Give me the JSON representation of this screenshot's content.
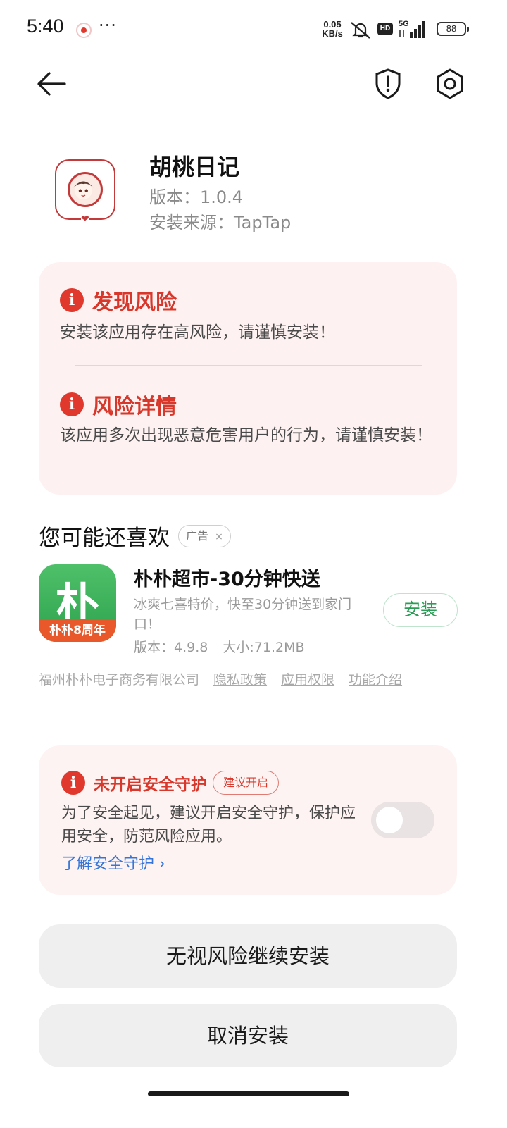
{
  "status_bar": {
    "time": "5:40",
    "dots": "···",
    "net_speed_value": "0.05",
    "net_speed_unit": "KB/s",
    "hd": "HD",
    "network": "5G",
    "battery": "88"
  },
  "nav": {
    "back_icon": "arrow-left-icon",
    "shield_icon": "shield-alert-icon",
    "settings_icon": "gear-icon"
  },
  "app": {
    "name": "胡桃日记",
    "version": "版本：1.0.4",
    "source": "安装来源：TapTap"
  },
  "risk": {
    "found_title": "发现风险",
    "found_text": "安装该应用存在高风险，请谨慎安装！",
    "detail_title": "风险详情",
    "detail_text": "该应用多次出现恶意危害用户的行为，请谨慎安装！"
  },
  "recommend": {
    "title": "您可能还喜欢",
    "ad_label": "广告",
    "ad_close": "×",
    "item": {
      "icon_char": "朴",
      "icon_band": "朴朴8周年",
      "name": "朴朴超市-30分钟快送",
      "desc": "冰爽七喜特价，快至30分钟送到家门口！",
      "version": "版本：4.9.8",
      "size": "大小:71.2MB",
      "install_label": "安装"
    },
    "company": "福州朴朴电子商务有限公司",
    "links": [
      "隐私政策",
      "应用权限",
      "功能介绍"
    ]
  },
  "protect": {
    "title": "未开启安全守护",
    "badge": "建议开启",
    "text": "为了安全起见，建议开启安全守护，保护应用安全，防范风险应用。",
    "link": "了解安全守护 ›",
    "toggle_on": false
  },
  "buttons": {
    "continue": "无视风险继续安装",
    "cancel": "取消安装"
  },
  "colors": {
    "danger": "#d8382b",
    "link": "#3575d8",
    "install_green": "#2c9d57"
  }
}
